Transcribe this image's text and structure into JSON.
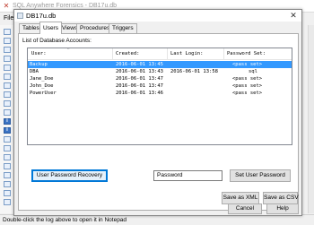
{
  "background": {
    "title": "SQL Anywhere Forensics - DB17u.db",
    "menu_file": "File",
    "status": "Double-click the log above to open it in Notepad"
  },
  "dialog": {
    "title": "DB17u.db",
    "tabs": [
      {
        "label": "Tables",
        "active": false
      },
      {
        "label": "Users",
        "active": true
      },
      {
        "label": "Views",
        "active": false
      },
      {
        "label": "Procedures",
        "active": false
      },
      {
        "label": "Triggers",
        "active": false
      }
    ],
    "list_label": "List of Database Accounts:",
    "columns": [
      "User:",
      "Created:",
      "Last Login:",
      "Password Set:"
    ],
    "rows": [
      {
        "user": "Backup",
        "created": "2016-06-01 13:45",
        "last_login": "",
        "password_set": "<pass set>",
        "selected": true
      },
      {
        "user": "DBA",
        "created": "2016-06-01 13:43",
        "last_login": "2016-06-01 13:58",
        "password_set": "sql",
        "selected": false
      },
      {
        "user": "Jane_Doe",
        "created": "2016-06-01 13:47",
        "last_login": "",
        "password_set": "<pass set>",
        "selected": false
      },
      {
        "user": "John_Doe",
        "created": "2016-06-01 13:47",
        "last_login": "",
        "password_set": "<pass set>",
        "selected": false
      },
      {
        "user": "PowerUser",
        "created": "2016-06-01 13:46",
        "last_login": "",
        "password_set": "<pass set>",
        "selected": false
      }
    ],
    "buttons": {
      "recovery": "User Password Recovery",
      "set_password": "Set User Password",
      "save_xml": "Save as XML",
      "save_csv": "Save as CSV",
      "cancel": "Cancel",
      "help": "Help"
    },
    "password_field_value": "P",
    "password_field_placeholder": "assword"
  },
  "colors": {
    "selection": "#3399ff",
    "focus_border": "#0078d7"
  }
}
